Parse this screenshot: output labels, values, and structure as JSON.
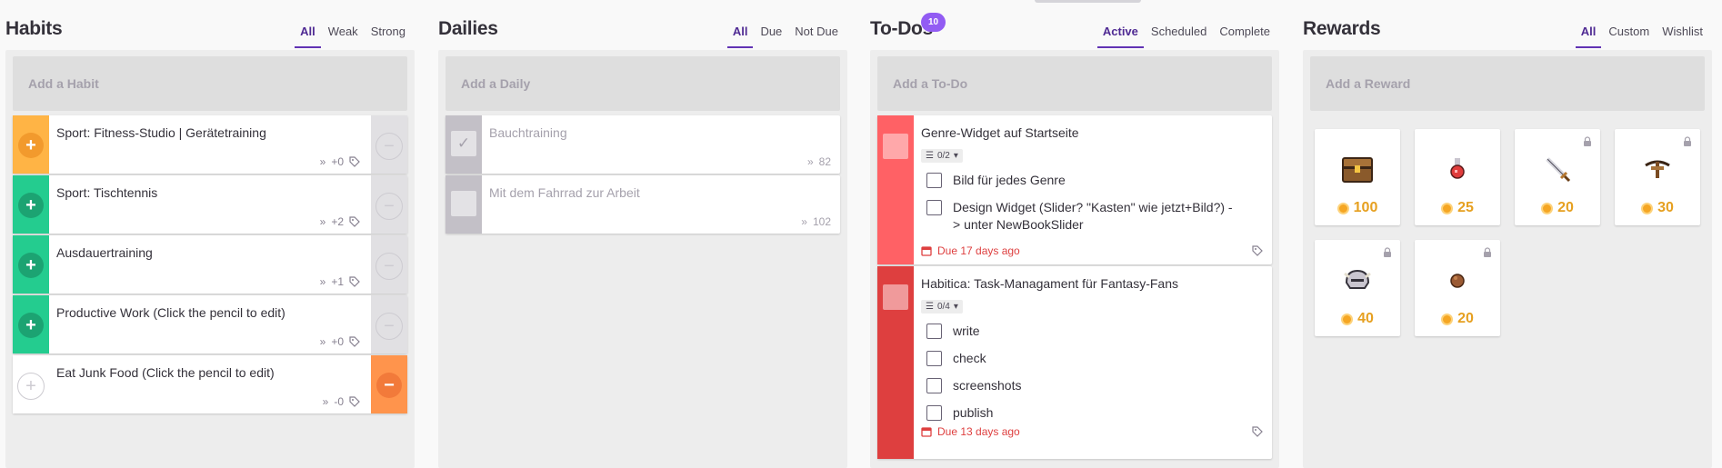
{
  "habits": {
    "title": "Habits",
    "filters": [
      "All",
      "Weak",
      "Strong"
    ],
    "add_placeholder": "Add a Habit",
    "items": [
      {
        "text": "Sport: Fitness-Studio | Gerätetraining",
        "counter": "+0"
      },
      {
        "text": "Sport: Tischtennis",
        "counter": "+2"
      },
      {
        "text": "Ausdauertraining",
        "counter": "+1"
      },
      {
        "text": "Productive Work (Click the pencil to edit)",
        "counter": "+0"
      },
      {
        "text": "Eat Junk Food (Click the pencil to edit)",
        "counter": "-0"
      }
    ]
  },
  "dailies": {
    "title": "Dailies",
    "filters": [
      "All",
      "Due",
      "Not Due"
    ],
    "add_placeholder": "Add a Daily",
    "items": [
      {
        "text": "Bauchtraining",
        "streak": "82"
      },
      {
        "text": "Mit dem Fahrrad zur Arbeit",
        "streak": "102"
      }
    ]
  },
  "todos": {
    "title": "To-Dos",
    "badge": "10",
    "filters": [
      "Active",
      "Scheduled",
      "Complete"
    ],
    "add_placeholder": "Add a To-Do",
    "items": [
      {
        "text": "Genre-Widget auf Startseite",
        "checklist_count": "0/2",
        "checklist": [
          "Bild für jedes Genre",
          "Design Widget (Slider? \"Kasten\" wie jetzt+Bild?) -> unter NewBookSlider"
        ],
        "due": "Due 17 days ago"
      },
      {
        "text": "Habitica: Task-Managament für Fantasy-Fans",
        "checklist_count": "0/4",
        "checklist": [
          "write",
          "check",
          "screenshots",
          "publish"
        ],
        "due": "Due 13 days ago"
      }
    ]
  },
  "rewards": {
    "title": "Rewards",
    "filters": [
      "All",
      "Custom",
      "Wishlist"
    ],
    "add_placeholder": "Add a Reward",
    "items": [
      {
        "icon": "treasure-chest-icon",
        "price": "100",
        "locked": false
      },
      {
        "icon": "potion-icon",
        "price": "25",
        "locked": false
      },
      {
        "icon": "sword-icon",
        "price": "20",
        "locked": true
      },
      {
        "icon": "crossbow-icon",
        "price": "30",
        "locked": true
      },
      {
        "icon": "helmet-icon",
        "price": "40",
        "locked": true
      },
      {
        "icon": "egg-icon",
        "price": "20",
        "locked": true
      }
    ]
  },
  "colors": {
    "accent": "#6133b4",
    "badge": "#925cf3",
    "gold": "#e6a020",
    "due_red": "#de3f3f"
  }
}
